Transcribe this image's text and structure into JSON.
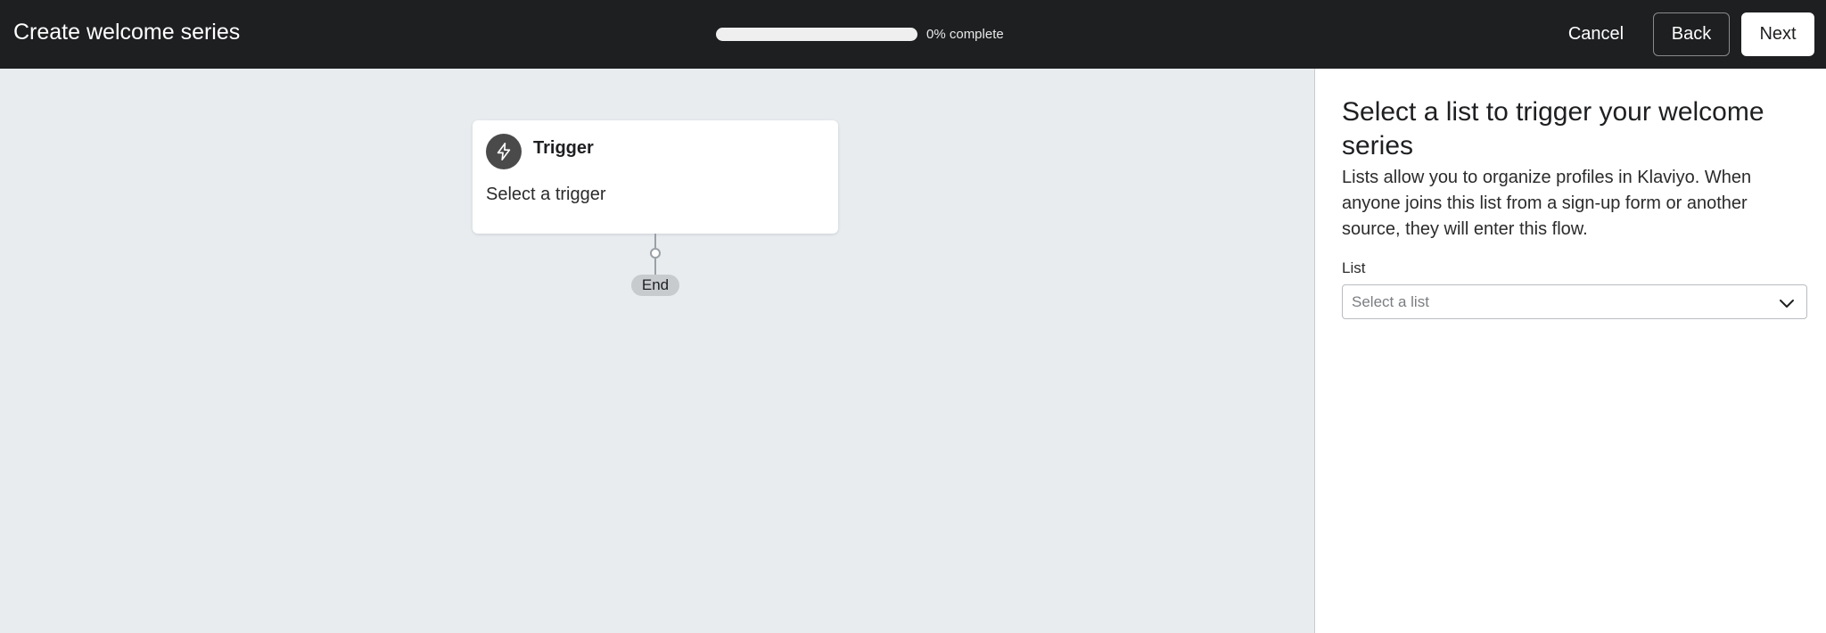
{
  "header": {
    "title": "Create welcome series",
    "progress_fraction": 0,
    "progress_text": "0% complete",
    "cancel_label": "Cancel",
    "back_label": "Back",
    "next_label": "Next"
  },
  "canvas": {
    "trigger": {
      "icon": "lightning-icon",
      "title": "Trigger",
      "subtitle": "Select a trigger"
    },
    "end_label": "End"
  },
  "panel": {
    "heading": "Select a list to trigger your welcome series",
    "description": "Lists allow you to organize profiles in Klaviyo. When anyone joins this list from a sign-up form or another source, they will enter this flow.",
    "list_field": {
      "label": "List",
      "placeholder": "Select a list",
      "icon": "chevron-down-icon"
    }
  },
  "colors": {
    "topbar": "#1e1f21",
    "canvas": "#e8ecef",
    "panel": "#ffffff",
    "trigger_icon_bg": "#4a4a4a"
  }
}
